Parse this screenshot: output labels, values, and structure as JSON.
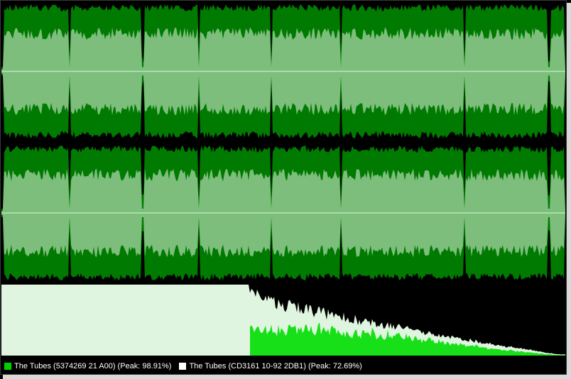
{
  "colors": {
    "background": "#000000",
    "dark_green": "#007a00",
    "light_green": "#7dbe7d",
    "centerline": "#b8e6b8",
    "spectrum_fill": "#dff5df",
    "spectrum_bright": "#18e018",
    "legend_green": "#00d000",
    "legend_white": "#ffffff"
  },
  "legend": [
    {
      "label": "The Tubes (5374269 21 A00) (Peak: 98.91%)",
      "color": "#00d000"
    },
    {
      "label": "The Tubes (CD3161  10-92 2DB1) (Peak: 72.69%)",
      "color": "#ffffff"
    }
  ]
}
